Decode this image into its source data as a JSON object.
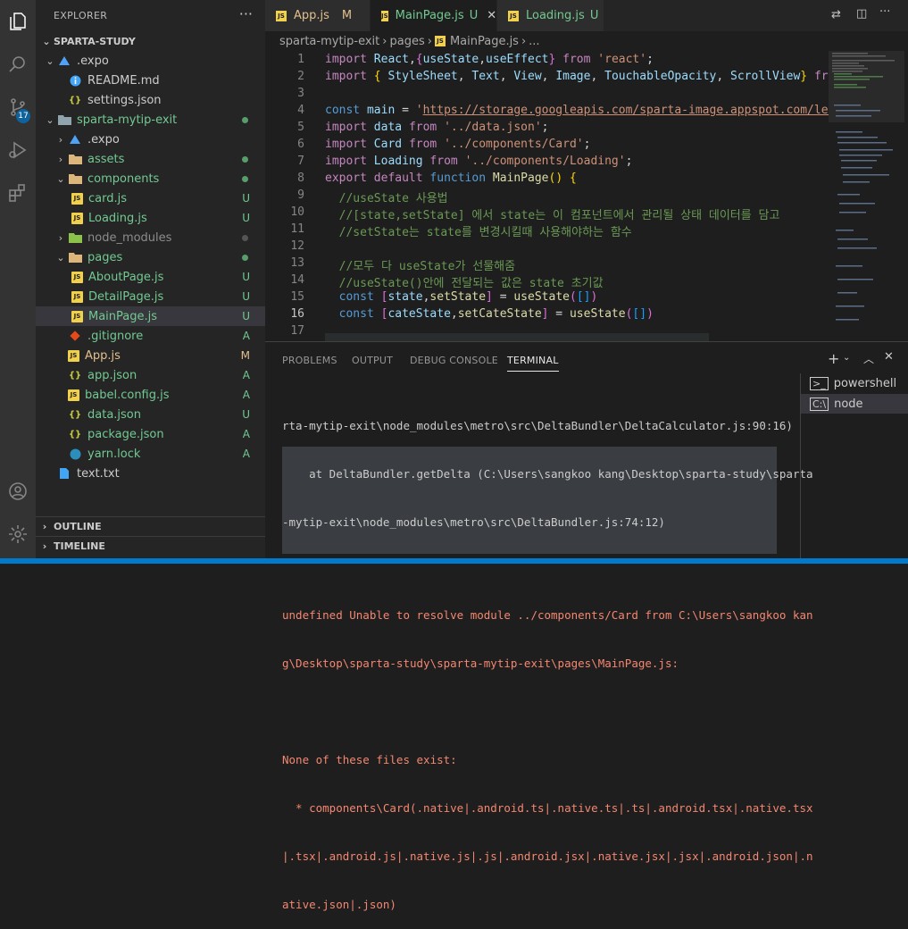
{
  "sidebar": {
    "title": "EXPLORER",
    "more": "···",
    "root": "SPARTA-STUDY",
    "tree": [
      {
        "label": ".expo",
        "depth": 1,
        "chev": "⌄",
        "icon": "expo-folder-icon",
        "status": ""
      },
      {
        "label": "README.md",
        "depth": 2,
        "chev": "",
        "icon": "info-icon",
        "status": ""
      },
      {
        "label": "settings.json",
        "depth": 2,
        "chev": "",
        "icon": "json-icon",
        "status": ""
      },
      {
        "label": "sparta-mytip-exit",
        "depth": 1,
        "chev": "⌄",
        "icon": "folder-icon",
        "status": "dot",
        "color": "green"
      },
      {
        "label": ".expo",
        "depth": 2,
        "chev": "›",
        "icon": "expo-folder-icon",
        "status": ""
      },
      {
        "label": "assets",
        "depth": 2,
        "chev": "›",
        "icon": "folder-icon",
        "status": "dot",
        "color": "green"
      },
      {
        "label": "components",
        "depth": 2,
        "chev": "⌄",
        "icon": "folder-icon",
        "status": "dot",
        "color": "green"
      },
      {
        "label": "card.js",
        "depth": 3,
        "chev": "",
        "icon": "js-icon",
        "status": "U",
        "color": "green"
      },
      {
        "label": "Loading.js",
        "depth": 3,
        "chev": "",
        "icon": "js-icon",
        "status": "U",
        "color": "green"
      },
      {
        "label": "node_modules",
        "depth": 2,
        "chev": "›",
        "icon": "folder-icon",
        "status": "dot",
        "color": "grey"
      },
      {
        "label": "pages",
        "depth": 2,
        "chev": "⌄",
        "icon": "folder-icon",
        "status": "dot",
        "color": "green"
      },
      {
        "label": "AboutPage.js",
        "depth": 3,
        "chev": "",
        "icon": "js-icon",
        "status": "U",
        "color": "green"
      },
      {
        "label": "DetailPage.js",
        "depth": 3,
        "chev": "",
        "icon": "js-icon",
        "status": "U",
        "color": "green"
      },
      {
        "label": "MainPage.js",
        "depth": 3,
        "chev": "",
        "icon": "js-icon",
        "status": "U",
        "color": "green",
        "selected": true
      },
      {
        "label": ".gitignore",
        "depth": 2,
        "chev": "",
        "icon": "git-icon",
        "status": "A",
        "color": "green"
      },
      {
        "label": "App.js",
        "depth": 2,
        "chev": "",
        "icon": "js-icon",
        "status": "M",
        "color": "yellow"
      },
      {
        "label": "app.json",
        "depth": 2,
        "chev": "",
        "icon": "json-icon",
        "status": "A",
        "color": "green"
      },
      {
        "label": "babel.config.js",
        "depth": 2,
        "chev": "",
        "icon": "js-icon",
        "status": "A",
        "color": "green"
      },
      {
        "label": "data.json",
        "depth": 2,
        "chev": "",
        "icon": "json-icon",
        "status": "U",
        "color": "green"
      },
      {
        "label": "package.json",
        "depth": 2,
        "chev": "",
        "icon": "json-icon",
        "status": "A",
        "color": "green"
      },
      {
        "label": "yarn.lock",
        "depth": 2,
        "chev": "",
        "icon": "yarn-icon",
        "status": "A",
        "color": "green"
      },
      {
        "label": "text.txt",
        "depth": 1,
        "chev": "",
        "icon": "text-file-icon",
        "status": ""
      }
    ],
    "outline": "OUTLINE",
    "timeline": "TIMELINE"
  },
  "activity": {
    "scm_badge": "17"
  },
  "tabs": [
    {
      "label": "App.js",
      "status": "M",
      "color": "yellow"
    },
    {
      "label": "MainPage.js",
      "status": "U",
      "color": "green",
      "active": true
    },
    {
      "label": "Loading.js",
      "status": "U",
      "color": "green"
    }
  ],
  "breadcrumb": [
    "sparta-mytip-exit",
    "pages",
    "MainPage.js",
    "..."
  ],
  "editor": {
    "line_numbers": [
      "1",
      "2",
      "3",
      "4",
      "5",
      "6",
      "7",
      "8",
      "9",
      "10",
      "11",
      "12",
      "13",
      "14",
      "15",
      "16",
      "17"
    ]
  },
  "panel": {
    "tabs": [
      "PROBLEMS",
      "OUTPUT",
      "DEBUG CONSOLE",
      "TERMINAL"
    ],
    "terminal_lines": [
      "rta-mytip-exit\\node_modules\\metro\\src\\DeltaBundler\\DeltaCalculator.js:90:16)",
      "    at DeltaBundler.getDelta (C:\\Users\\sangkoo kang\\Desktop\\sparta-study\\sparta",
      "-mytip-exit\\node_modules\\metro\\src\\DeltaBundler.js:74:12)"
    ],
    "error_lines": [
      "undefined Unable to resolve module ../components/Card from C:\\Users\\sangkoo kan",
      "g\\Desktop\\sparta-study\\sparta-mytip-exit\\pages\\MainPage.js:",
      "",
      "None of these files exist:",
      "  * components\\Card(.native|.android.ts|.native.ts|.ts|.android.tsx|.native.tsx",
      "|.tsx|.android.js|.native.js|.js|.android.jsx|.native.jsx|.jsx|.android.json|.n",
      "ative.json|.json)"
    ],
    "terminals": [
      "powershell",
      "node"
    ]
  },
  "colors": {
    "accent": "#007acc",
    "green": "#73c991",
    "yellow": "#e2c08d"
  }
}
